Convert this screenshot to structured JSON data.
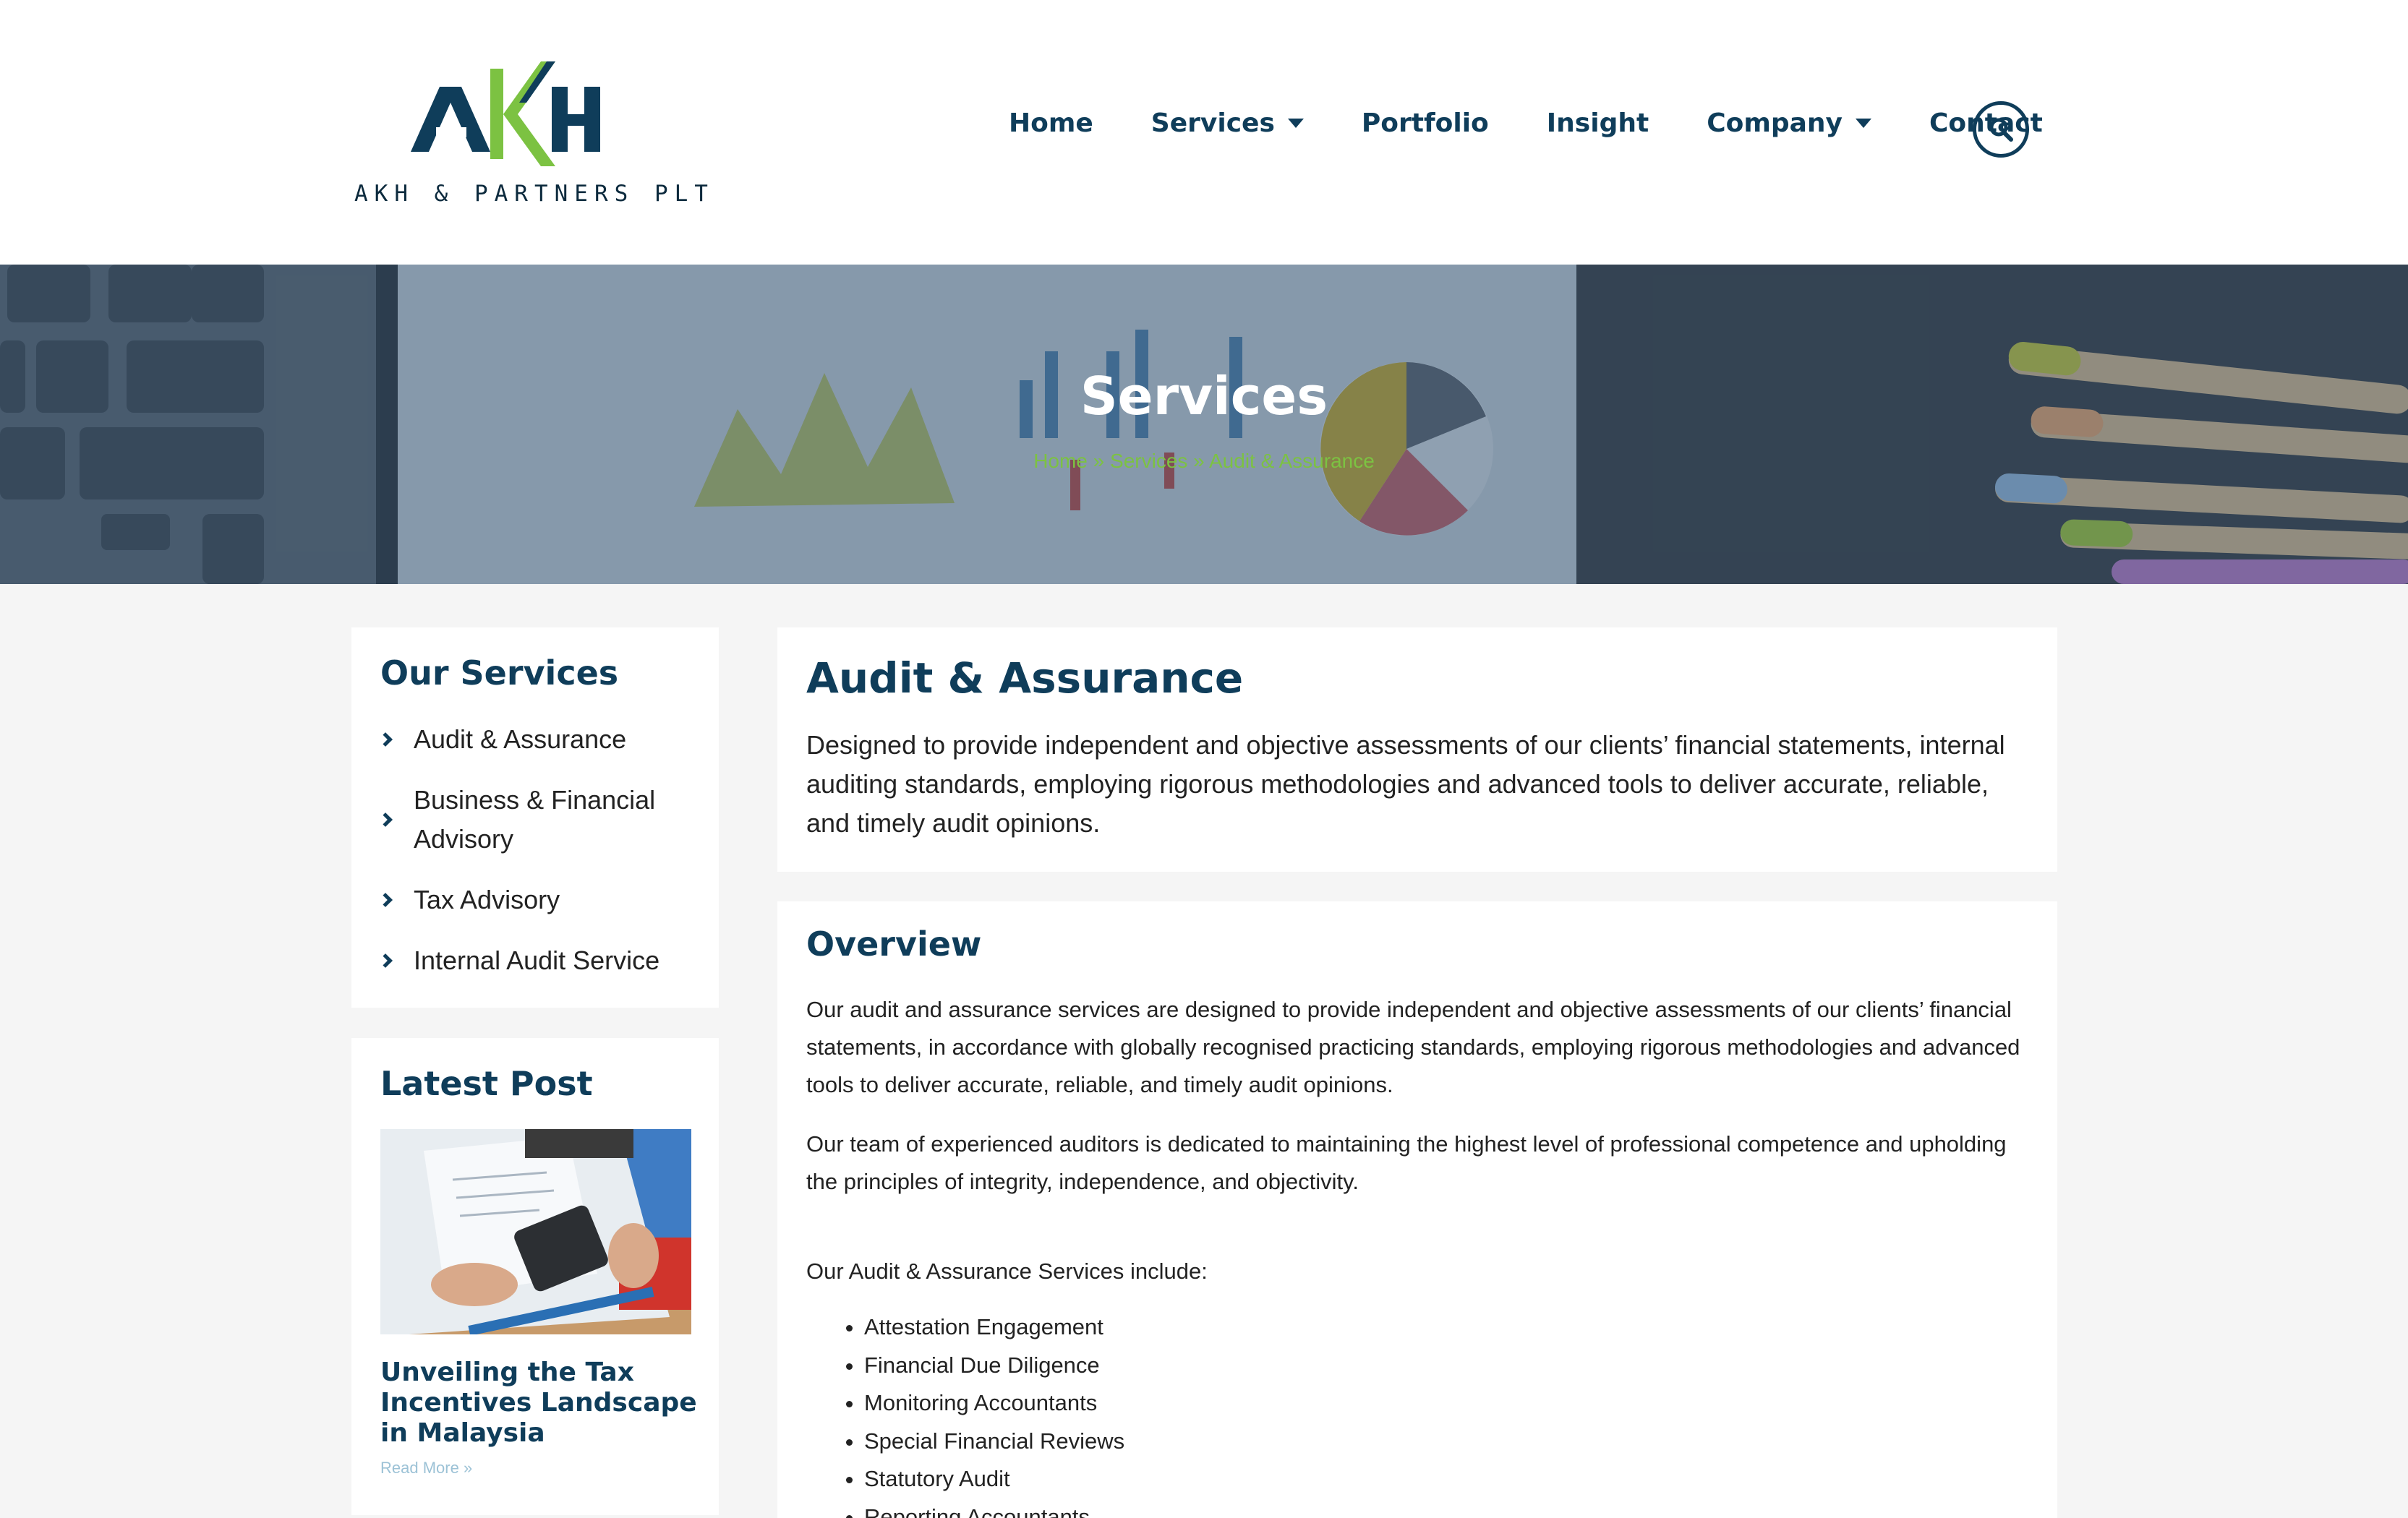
{
  "header": {
    "logo_text": "AKH & PARTNERS PLT",
    "logo_mark": "AKH",
    "nav": [
      {
        "label": "Home",
        "has_dropdown": false
      },
      {
        "label": "Services",
        "has_dropdown": true
      },
      {
        "label": "Portfolio",
        "has_dropdown": false
      },
      {
        "label": "Insight",
        "has_dropdown": false
      },
      {
        "label": "Company",
        "has_dropdown": true
      },
      {
        "label": "Contact",
        "has_dropdown": false
      }
    ],
    "search_icon": "search-icon"
  },
  "hero": {
    "title": "Services",
    "breadcrumb": {
      "home": "Home",
      "sep1": " » ",
      "services": "Services",
      "sep2": " » ",
      "current": "Audit & Assurance"
    }
  },
  "sidebar": {
    "services_title": "Our Services",
    "services": [
      "Audit & Assurance",
      "Business & Financial Advisory",
      "Tax Advisory",
      "Internal Audit Service"
    ],
    "latest_title": "Latest Post",
    "post_title": "Unveiling the Tax Incentives Landscape in Malaysia",
    "read_more": "Read More »"
  },
  "main": {
    "title": "Audit & Assurance",
    "description": "Designed to provide independent and objective assessments of our clients’ financial statements, internal auditing standards, employing rigorous methodologies and advanced tools to deliver accurate, reliable, and timely audit opinions.",
    "overview_title": "Overview",
    "overview_p1": "Our audit and assurance services are designed to provide independent and objective assessments of our clients’ financial statements, in accordance with globally recognised practicing standards, employing rigorous methodologies and advanced tools to deliver accurate, reliable, and timely audit opinions.",
    "overview_p2": "Our team of experienced auditors is dedicated to maintaining the highest level of professional competence and upholding the principles of integrity, independence, and objectivity.",
    "includes_label": "Our Audit & Assurance Services include:",
    "services_list": [
      "Attestation Engagement",
      "Financial Due Diligence",
      "Monitoring Accountants",
      "Special Financial Reviews",
      "Statutory Audit",
      "Reporting Accountants"
    ]
  },
  "colors": {
    "brand_navy": "#0f3d5a",
    "brand_green": "#7cc242",
    "background": "#f5f5f5"
  }
}
